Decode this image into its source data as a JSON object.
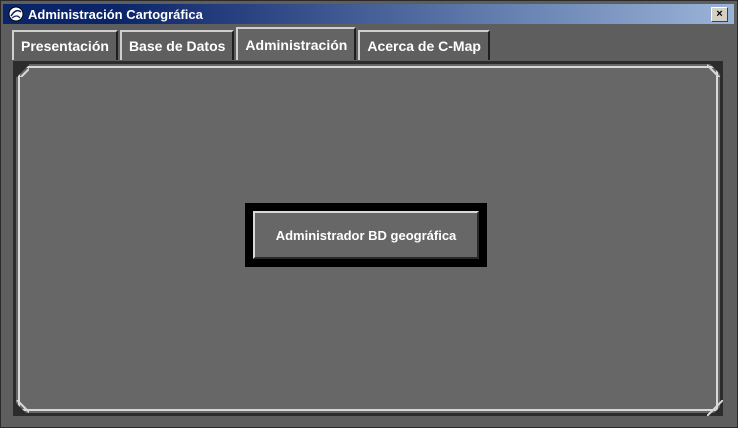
{
  "window": {
    "title": "Administración Cartográfica",
    "close_label": "×"
  },
  "tabs": [
    {
      "label": "Presentación",
      "active": false
    },
    {
      "label": "Base de Datos",
      "active": false
    },
    {
      "label": "Administración",
      "active": true
    },
    {
      "label": "Acerca de C-Map",
      "active": false
    }
  ],
  "panel": {
    "main_button_label": "Administrador BD geográfica"
  },
  "colors": {
    "titlebar_start": "#0a246a",
    "titlebar_end": "#9ab4d8",
    "panel_bg": "#676767",
    "text": "#ffffff"
  }
}
